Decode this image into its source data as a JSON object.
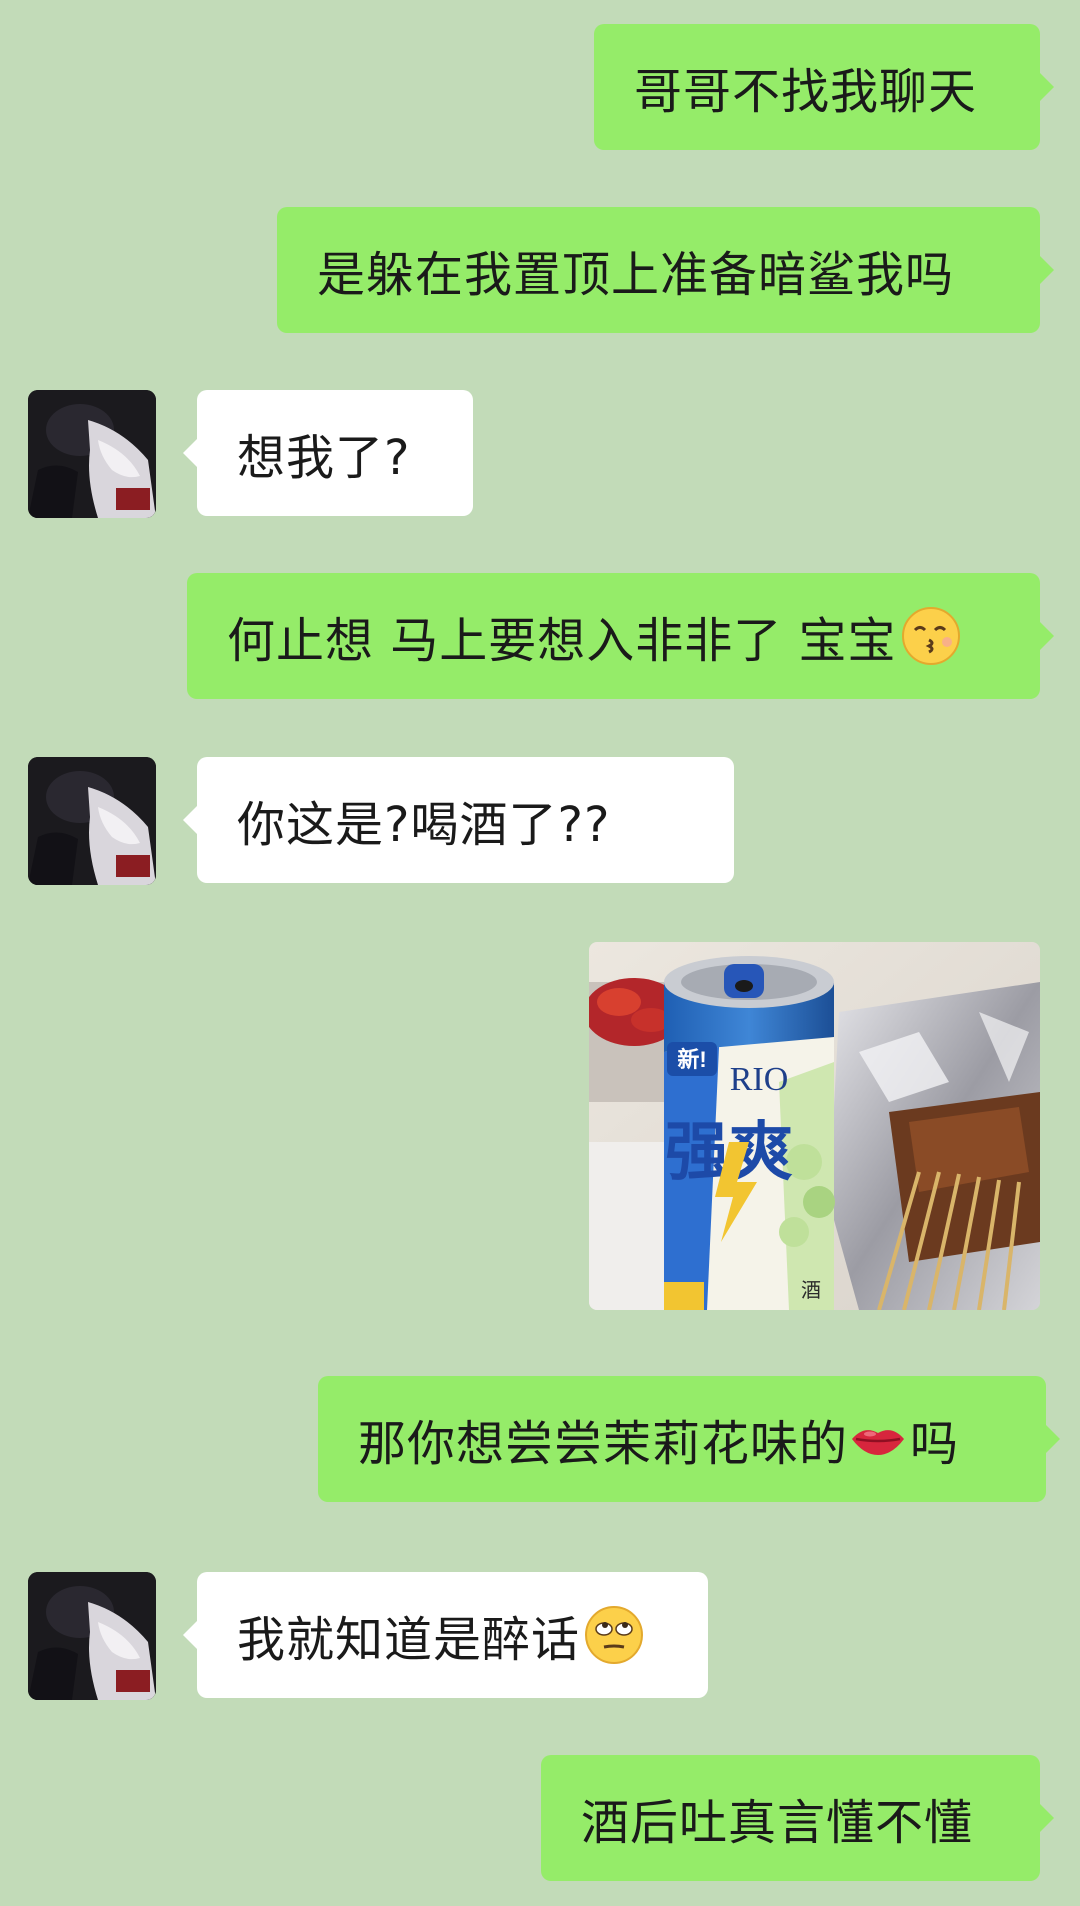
{
  "messages": [
    {
      "side": "out",
      "text": "哥哥不找我聊天"
    },
    {
      "side": "out",
      "text": "是躲在我置顶上准备暗鲨我吗"
    },
    {
      "side": "in",
      "text": "想我了?"
    },
    {
      "side": "out",
      "text": "何止想 马上要想入非非了 宝宝",
      "emoji": "kissing-face-emoji"
    },
    {
      "side": "in",
      "text": "你这是?喝酒了??"
    },
    {
      "side": "out",
      "type": "image",
      "image": "photo-rio-can-and-skewers"
    },
    {
      "side": "out",
      "text_before": "那你想尝尝茉莉花味的",
      "emoji": "lips-emoji",
      "text_after": "吗"
    },
    {
      "side": "in",
      "text": "我就知道是醉话",
      "emoji": "eye-roll-face-emoji"
    },
    {
      "side": "out",
      "text": "酒后吐真言懂不懂"
    }
  ],
  "photo": {
    "can_badge": "新!",
    "can_brand": "RIO",
    "can_name": "强爽",
    "can_note": "酒"
  },
  "colors": {
    "background": "#c2dbb8",
    "outgoing_bubble": "#95ec69",
    "incoming_bubble": "#ffffff"
  }
}
